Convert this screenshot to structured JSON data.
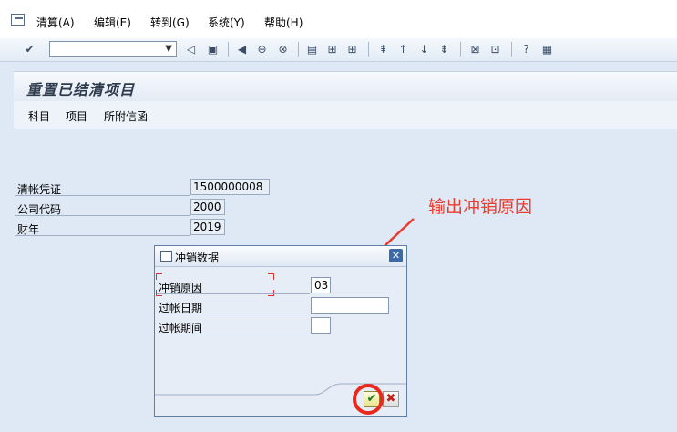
{
  "menu": {
    "items": [
      "清算(A)",
      "编辑(E)",
      "转到(G)",
      "系统(Y)",
      "帮助(H)"
    ]
  },
  "toolbar": {
    "command_value": ""
  },
  "screen": {
    "title": "重置已结清项目",
    "app_toolbar": [
      "科目",
      "项目",
      "所附信函"
    ]
  },
  "form": {
    "clearing_doc_label": "清帐凭证",
    "clearing_doc_value": "1500000008",
    "company_code_label": "公司代码",
    "company_code_value": "2000",
    "fiscal_year_label": "财年",
    "fiscal_year_value": "2019"
  },
  "annotation": {
    "text": "输出冲销原因",
    "color": "#e83c2e"
  },
  "dialog": {
    "title": "冲销数据",
    "close_glyph": "✕",
    "reason_label": "冲销原因",
    "reason_value": "03",
    "posting_date_label": "过帐日期",
    "posting_date_value": "",
    "posting_period_label": "过帐期间",
    "posting_period_value": "",
    "ok_glyph": "✔",
    "cancel_glyph": "✖"
  }
}
